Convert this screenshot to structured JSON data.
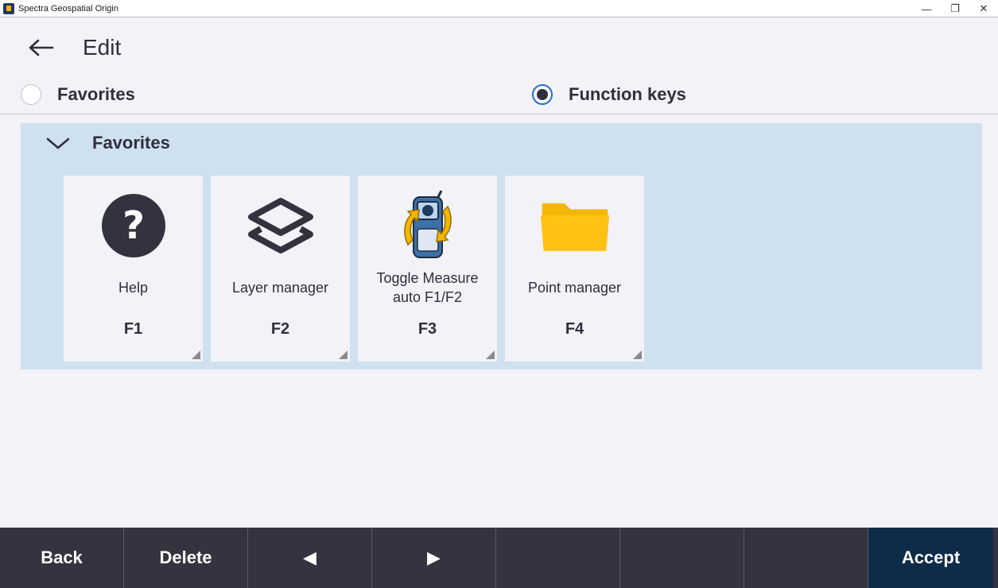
{
  "window": {
    "title": "Spectra Geospatial Origin",
    "minimize_glyph": "—",
    "restore_glyph": "❐",
    "close_glyph": "✕"
  },
  "header": {
    "back_icon": "back-arrow-icon",
    "title": "Edit"
  },
  "mode_selector": {
    "options": [
      {
        "label": "Favorites",
        "checked": false
      },
      {
        "label": "Function keys",
        "checked": true
      }
    ],
    "accent_color": "#1f6fd1"
  },
  "favorites_panel": {
    "title": "Favorites",
    "expanded": true,
    "background": "#cfe0ef",
    "tiles": [
      {
        "label": "Help",
        "key": "F1",
        "icon": "help-icon"
      },
      {
        "label": "Layer manager",
        "key": "F2",
        "icon": "layers-icon"
      },
      {
        "label": "Toggle Measure auto F1/F2",
        "key": "F3",
        "icon": "toggle-measure-icon"
      },
      {
        "label": "Point manager",
        "key": "F4",
        "icon": "folder-icon"
      }
    ]
  },
  "bottom_bar": {
    "buttons": [
      {
        "label": "Back"
      },
      {
        "label": "Delete"
      },
      {
        "label": "◀"
      },
      {
        "label": "▶"
      },
      {
        "label": ""
      },
      {
        "label": ""
      },
      {
        "label": ""
      },
      {
        "label": "Accept"
      }
    ],
    "background": "#34333f",
    "accept_background": "#0d2c4a"
  }
}
